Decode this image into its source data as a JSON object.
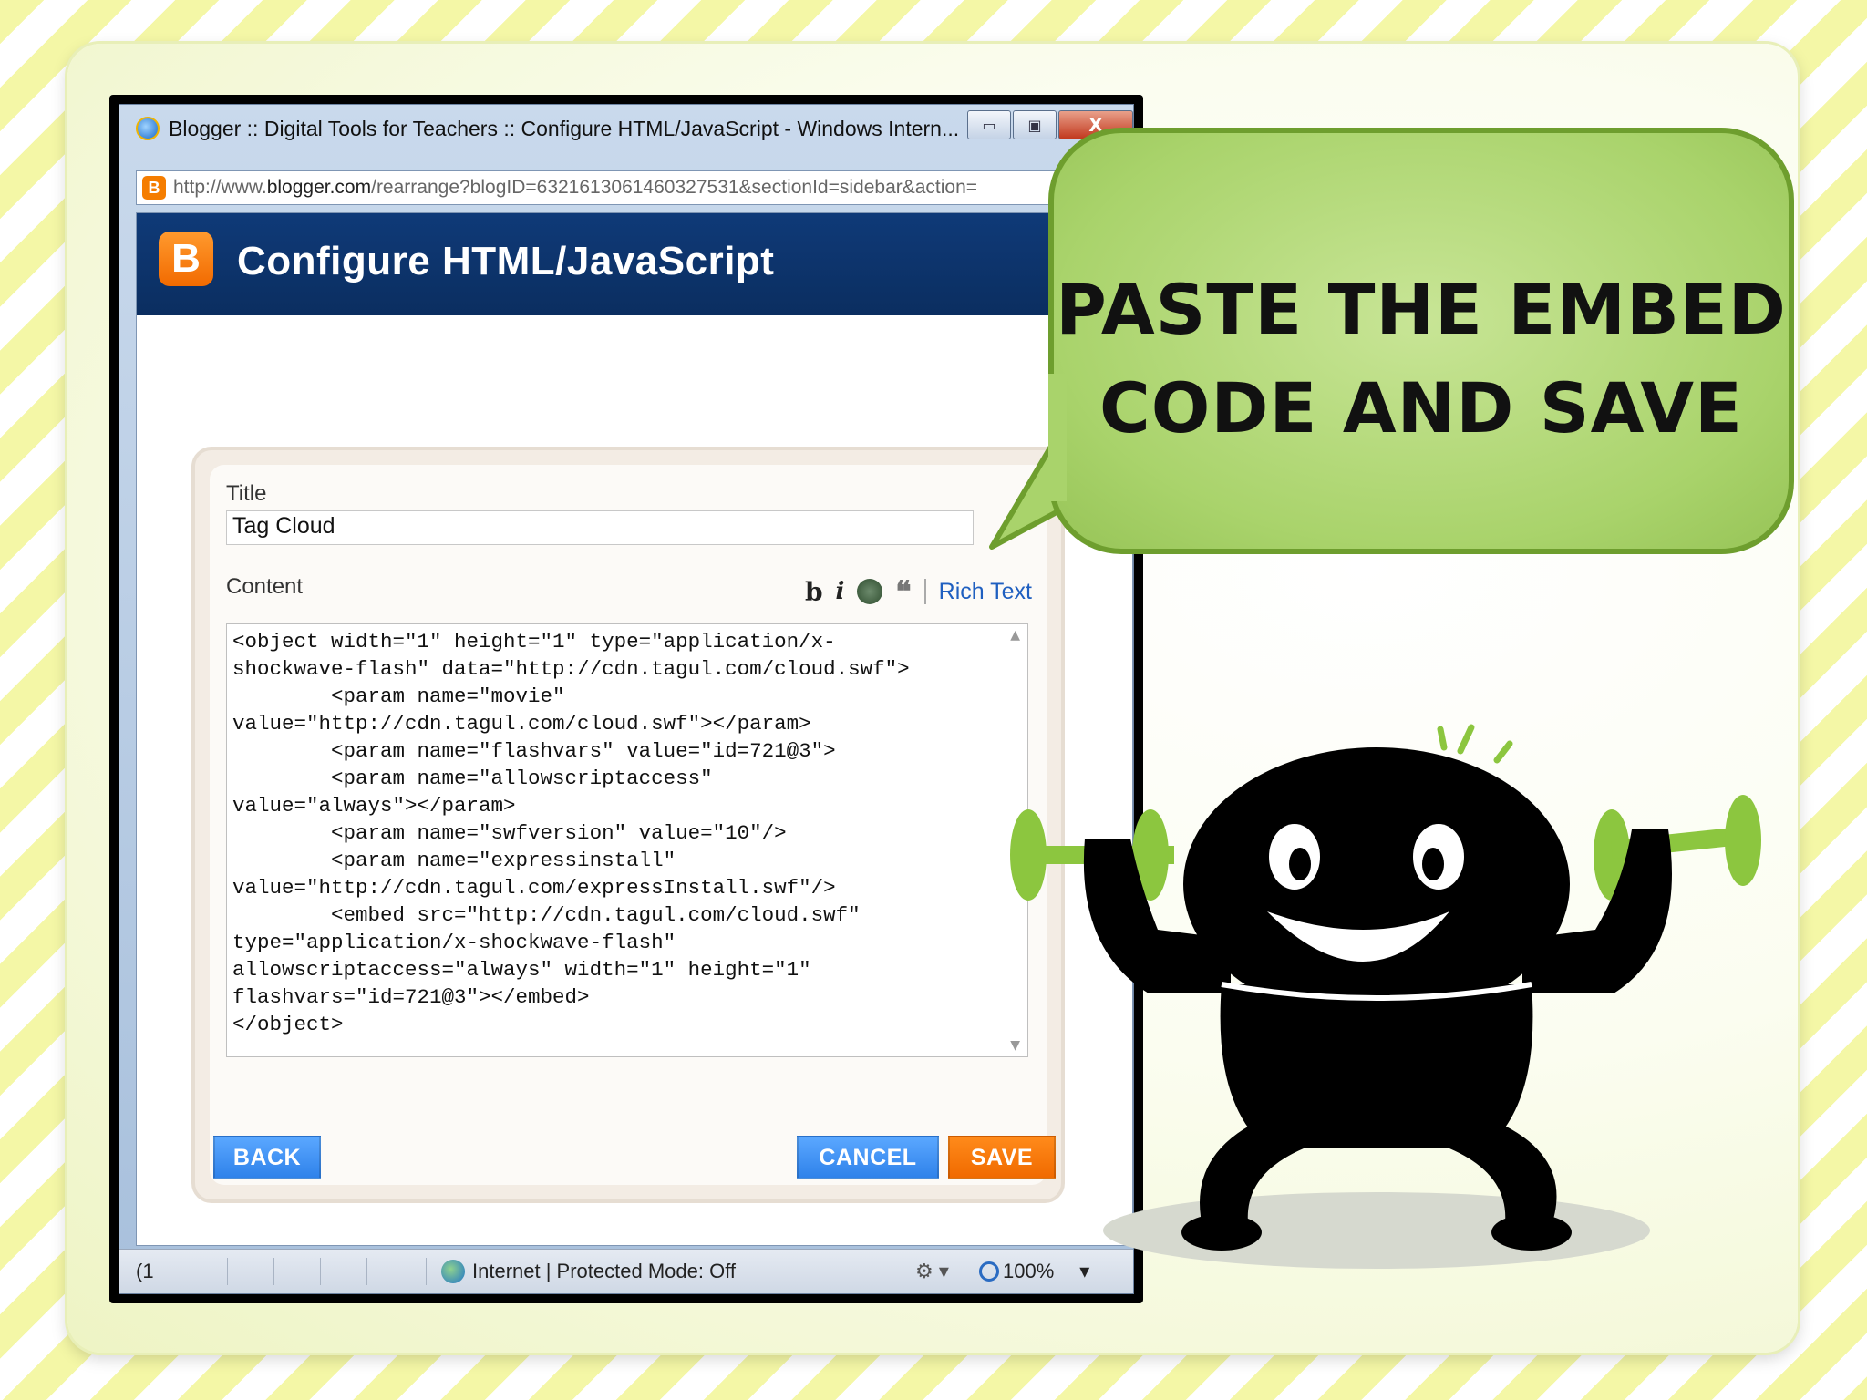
{
  "browser": {
    "title": "Blogger :: Digital Tools for Teachers :: Configure HTML/JavaScript - Windows Intern...",
    "url_prefix": "http://www.",
    "url_domain": "blogger.com",
    "url_path": "/rearrange?blogID=6321613061460327531&sectionId=sidebar&action=",
    "buttons": {
      "minimize": "▭",
      "maximize": "▣",
      "close": "X"
    }
  },
  "header": {
    "logo": "B",
    "title": "Configure HTML/JavaScript",
    "help": "?"
  },
  "form": {
    "title_label": "Title",
    "title_value": "Tag Cloud",
    "content_label": "Content",
    "toolbar": {
      "bold": "b",
      "italic": "i",
      "quote": "❝",
      "rich_text": "Rich Text"
    },
    "code": "<object width=\"1\" height=\"1\" type=\"application/x-\nshockwave-flash\" data=\"http://cdn.tagul.com/cloud.swf\">\n        <param name=\"movie\"\nvalue=\"http://cdn.tagul.com/cloud.swf\"></param>\n        <param name=\"flashvars\" value=\"id=721@3\">\n        <param name=\"allowscriptaccess\"\nvalue=\"always\"></param>\n        <param name=\"swfversion\" value=\"10\"/>\n        <param name=\"expressinstall\"\nvalue=\"http://cdn.tagul.com/expressInstall.swf\"/>\n        <embed src=\"http://cdn.tagul.com/cloud.swf\"\ntype=\"application/x-shockwave-flash\"\nallowscriptaccess=\"always\" width=\"1\" height=\"1\"\nflashvars=\"id=721@3\"></embed>\n</object>",
    "back_label": "BACK",
    "cancel_label": "CANCEL",
    "save_label": "SAVE"
  },
  "statusbar": {
    "left": "(1",
    "zone": "Internet | Protected Mode: Off",
    "zoom": "100%"
  },
  "callout": {
    "line1": "PASTE THE EMBED",
    "line2": "CODE AND SAVE"
  },
  "colors": {
    "blogger_orange": "#f57d00",
    "header_blue": "#0f3a78",
    "button_blue": "#2f82ea",
    "bubble_green": "#a9d36b",
    "dumbbell_green": "#8cc63f"
  }
}
